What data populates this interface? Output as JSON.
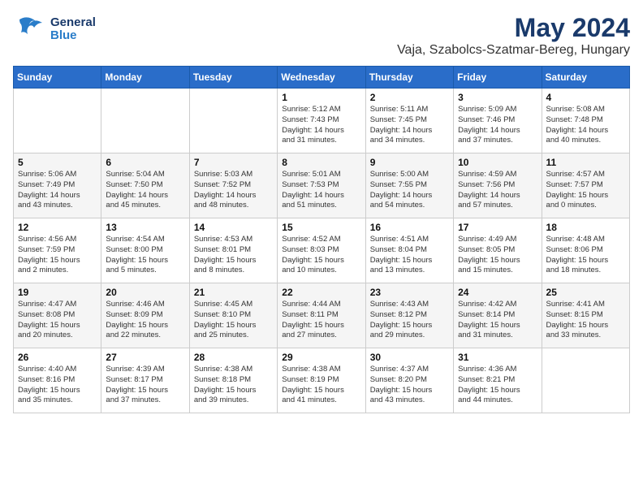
{
  "header": {
    "logo_line1": "General",
    "logo_line2": "Blue",
    "title": "May 2024",
    "subtitle": "Vaja, Szabolcs-Szatmar-Bereg, Hungary"
  },
  "days_of_week": [
    "Sunday",
    "Monday",
    "Tuesday",
    "Wednesday",
    "Thursday",
    "Friday",
    "Saturday"
  ],
  "weeks": [
    [
      {
        "day": "",
        "content": ""
      },
      {
        "day": "",
        "content": ""
      },
      {
        "day": "",
        "content": ""
      },
      {
        "day": "1",
        "content": "Sunrise: 5:12 AM\nSunset: 7:43 PM\nDaylight: 14 hours\nand 31 minutes."
      },
      {
        "day": "2",
        "content": "Sunrise: 5:11 AM\nSunset: 7:45 PM\nDaylight: 14 hours\nand 34 minutes."
      },
      {
        "day": "3",
        "content": "Sunrise: 5:09 AM\nSunset: 7:46 PM\nDaylight: 14 hours\nand 37 minutes."
      },
      {
        "day": "4",
        "content": "Sunrise: 5:08 AM\nSunset: 7:48 PM\nDaylight: 14 hours\nand 40 minutes."
      }
    ],
    [
      {
        "day": "5",
        "content": "Sunrise: 5:06 AM\nSunset: 7:49 PM\nDaylight: 14 hours\nand 43 minutes."
      },
      {
        "day": "6",
        "content": "Sunrise: 5:04 AM\nSunset: 7:50 PM\nDaylight: 14 hours\nand 45 minutes."
      },
      {
        "day": "7",
        "content": "Sunrise: 5:03 AM\nSunset: 7:52 PM\nDaylight: 14 hours\nand 48 minutes."
      },
      {
        "day": "8",
        "content": "Sunrise: 5:01 AM\nSunset: 7:53 PM\nDaylight: 14 hours\nand 51 minutes."
      },
      {
        "day": "9",
        "content": "Sunrise: 5:00 AM\nSunset: 7:55 PM\nDaylight: 14 hours\nand 54 minutes."
      },
      {
        "day": "10",
        "content": "Sunrise: 4:59 AM\nSunset: 7:56 PM\nDaylight: 14 hours\nand 57 minutes."
      },
      {
        "day": "11",
        "content": "Sunrise: 4:57 AM\nSunset: 7:57 PM\nDaylight: 15 hours\nand 0 minutes."
      }
    ],
    [
      {
        "day": "12",
        "content": "Sunrise: 4:56 AM\nSunset: 7:59 PM\nDaylight: 15 hours\nand 2 minutes."
      },
      {
        "day": "13",
        "content": "Sunrise: 4:54 AM\nSunset: 8:00 PM\nDaylight: 15 hours\nand 5 minutes."
      },
      {
        "day": "14",
        "content": "Sunrise: 4:53 AM\nSunset: 8:01 PM\nDaylight: 15 hours\nand 8 minutes."
      },
      {
        "day": "15",
        "content": "Sunrise: 4:52 AM\nSunset: 8:03 PM\nDaylight: 15 hours\nand 10 minutes."
      },
      {
        "day": "16",
        "content": "Sunrise: 4:51 AM\nSunset: 8:04 PM\nDaylight: 15 hours\nand 13 minutes."
      },
      {
        "day": "17",
        "content": "Sunrise: 4:49 AM\nSunset: 8:05 PM\nDaylight: 15 hours\nand 15 minutes."
      },
      {
        "day": "18",
        "content": "Sunrise: 4:48 AM\nSunset: 8:06 PM\nDaylight: 15 hours\nand 18 minutes."
      }
    ],
    [
      {
        "day": "19",
        "content": "Sunrise: 4:47 AM\nSunset: 8:08 PM\nDaylight: 15 hours\nand 20 minutes."
      },
      {
        "day": "20",
        "content": "Sunrise: 4:46 AM\nSunset: 8:09 PM\nDaylight: 15 hours\nand 22 minutes."
      },
      {
        "day": "21",
        "content": "Sunrise: 4:45 AM\nSunset: 8:10 PM\nDaylight: 15 hours\nand 25 minutes."
      },
      {
        "day": "22",
        "content": "Sunrise: 4:44 AM\nSunset: 8:11 PM\nDaylight: 15 hours\nand 27 minutes."
      },
      {
        "day": "23",
        "content": "Sunrise: 4:43 AM\nSunset: 8:12 PM\nDaylight: 15 hours\nand 29 minutes."
      },
      {
        "day": "24",
        "content": "Sunrise: 4:42 AM\nSunset: 8:14 PM\nDaylight: 15 hours\nand 31 minutes."
      },
      {
        "day": "25",
        "content": "Sunrise: 4:41 AM\nSunset: 8:15 PM\nDaylight: 15 hours\nand 33 minutes."
      }
    ],
    [
      {
        "day": "26",
        "content": "Sunrise: 4:40 AM\nSunset: 8:16 PM\nDaylight: 15 hours\nand 35 minutes."
      },
      {
        "day": "27",
        "content": "Sunrise: 4:39 AM\nSunset: 8:17 PM\nDaylight: 15 hours\nand 37 minutes."
      },
      {
        "day": "28",
        "content": "Sunrise: 4:38 AM\nSunset: 8:18 PM\nDaylight: 15 hours\nand 39 minutes."
      },
      {
        "day": "29",
        "content": "Sunrise: 4:38 AM\nSunset: 8:19 PM\nDaylight: 15 hours\nand 41 minutes."
      },
      {
        "day": "30",
        "content": "Sunrise: 4:37 AM\nSunset: 8:20 PM\nDaylight: 15 hours\nand 43 minutes."
      },
      {
        "day": "31",
        "content": "Sunrise: 4:36 AM\nSunset: 8:21 PM\nDaylight: 15 hours\nand 44 minutes."
      },
      {
        "day": "",
        "content": ""
      }
    ]
  ]
}
